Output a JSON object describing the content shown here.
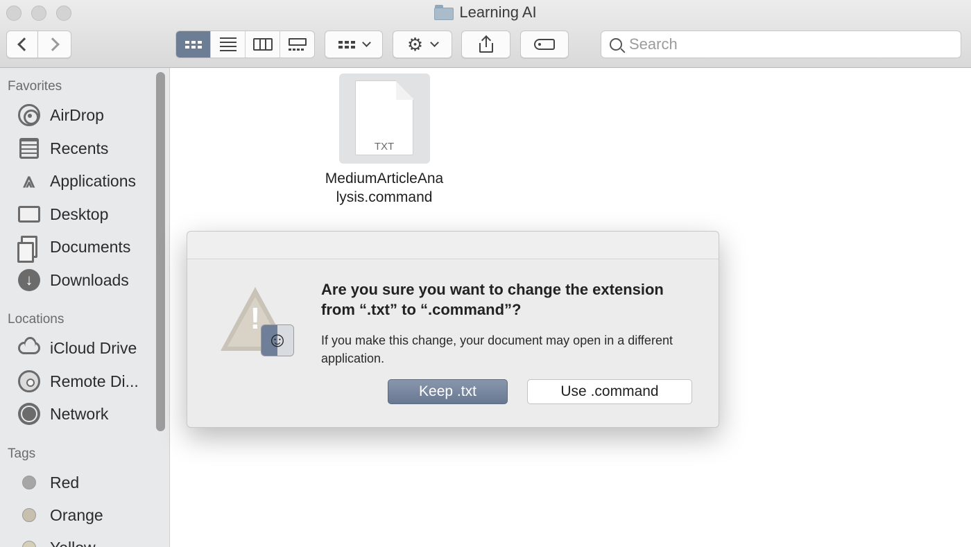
{
  "window": {
    "title": "Learning AI",
    "icon": "folder-icon"
  },
  "toolbar": {
    "back_icon": "chevron-left-icon",
    "forward_icon": "chevron-right-icon",
    "views": [
      "icon-view",
      "list-view",
      "column-view",
      "gallery-view"
    ],
    "active_view": "icon-view",
    "search_placeholder": "Search"
  },
  "sidebar": {
    "favorites_label": "Favorites",
    "favorites": [
      {
        "label": "AirDrop",
        "icon": "airdrop-icon"
      },
      {
        "label": "Recents",
        "icon": "recents-icon"
      },
      {
        "label": "Applications",
        "icon": "applications-icon"
      },
      {
        "label": "Desktop",
        "icon": "desktop-icon"
      },
      {
        "label": "Documents",
        "icon": "documents-icon"
      },
      {
        "label": "Downloads",
        "icon": "downloads-icon"
      }
    ],
    "locations_label": "Locations",
    "locations": [
      {
        "label": "iCloud Drive",
        "icon": "icloud-icon"
      },
      {
        "label": "Remote Di...",
        "icon": "remote-disc-icon"
      },
      {
        "label": "Network",
        "icon": "network-icon"
      }
    ],
    "tags_label": "Tags",
    "tags": [
      {
        "label": "Red",
        "color": "#a6a6a6"
      },
      {
        "label": "Orange",
        "color": "#c9bfae"
      },
      {
        "label": "Yellow",
        "color": "#d6cfb8"
      }
    ]
  },
  "file": {
    "ext_label": "TXT",
    "name_line1": "MediumArticleAna",
    "name_line2": "lysis.command"
  },
  "dialog": {
    "title": "Are you sure you want to change the extension from “.txt” to “.command”?",
    "message": "If you make this change, your document may open in a different application.",
    "keep_label": "Keep .txt",
    "use_label": "Use .command",
    "icon": "warning-icon"
  },
  "colors": {
    "accent": "#6d7d94",
    "sidebar_bg": "#e8e9eb",
    "dialog_bg": "#ececec"
  }
}
